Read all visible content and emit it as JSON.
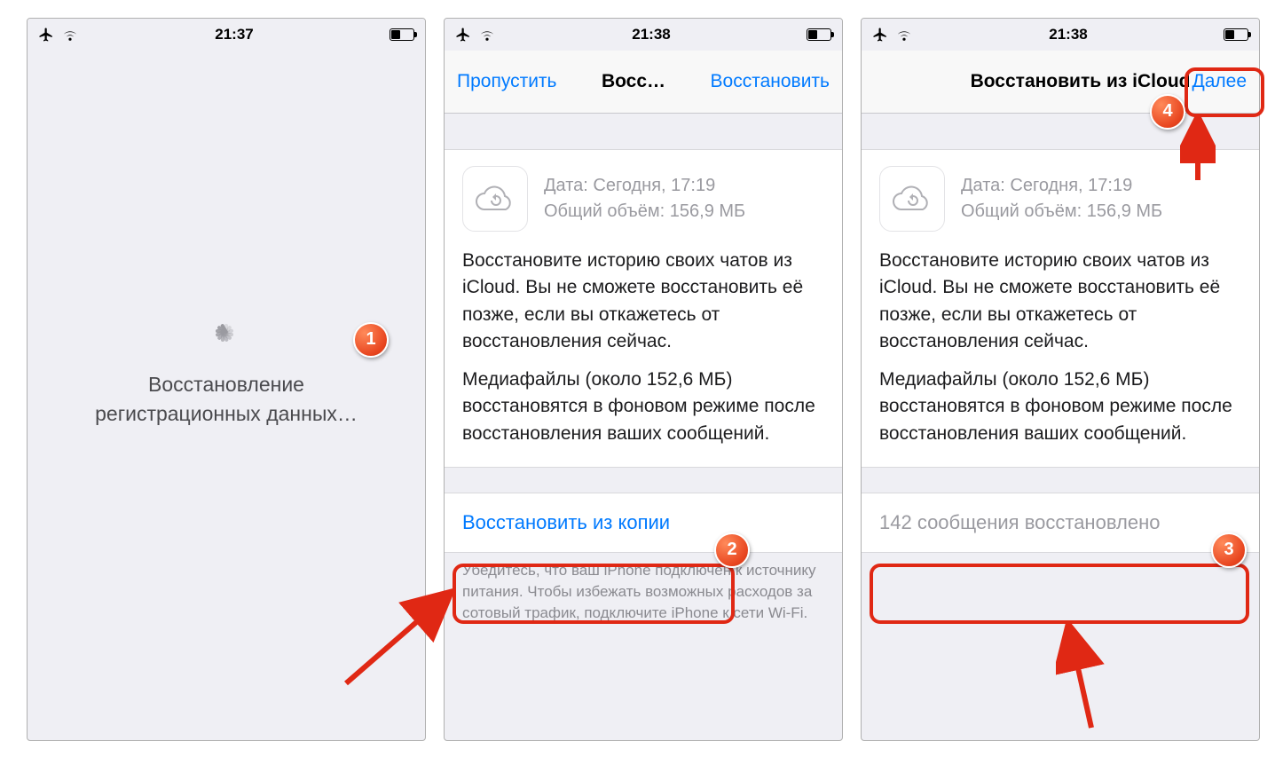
{
  "statusbar": {
    "time1": "21:37",
    "time2": "21:38",
    "time3": "21:38"
  },
  "screen1": {
    "loading_text": "Восстановление регистрационных данных…"
  },
  "screen2": {
    "nav": {
      "skip": "Пропустить",
      "title": "Восс…",
      "restore": "Восстановить"
    },
    "backup": {
      "date_label": "Дата: Сегодня, 17:19",
      "size_label": "Общий объём: 156,9 МБ"
    },
    "desc1": "Восстановите историю своих чатов из iCloud. Вы не сможете восстановить её позже, если вы откажетесь от восстановления сейчас.",
    "desc2": "Медиафайлы (около 152,6 МБ) восстановятся в фоновом режиме после восстановления ваших сообщений.",
    "restore_button": "Восстановить из копии",
    "footnote": "Убедитесь, что ваш iPhone подключен к источнику питания. Чтобы избежать возможных расходов за сотовый трафик, подключите iPhone к сети Wi-Fi."
  },
  "screen3": {
    "nav": {
      "title": "Восстановить из iCloud",
      "next": "Далее"
    },
    "backup": {
      "date_label": "Дата: Сегодня, 17:19",
      "size_label": "Общий объём: 156,9 МБ"
    },
    "desc1": "Восстановите историю своих чатов из iCloud. Вы не сможете восстановить её позже, если вы откажетесь от восстановления сейчас.",
    "desc2": "Медиафайлы (около 152,6 МБ) восстановятся в фоновом режиме после восстановления ваших сообщений.",
    "status_row": "142 сообщения восстановлено"
  },
  "annotations": {
    "n1": "1",
    "n2": "2",
    "n3": "3",
    "n4": "4"
  }
}
